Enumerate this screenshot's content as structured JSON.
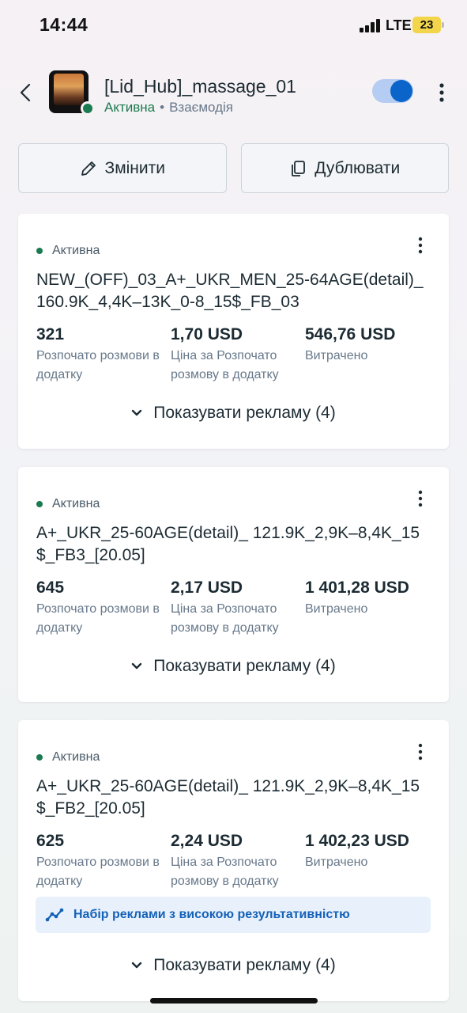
{
  "status_bar": {
    "time": "14:44",
    "network": "LTE",
    "battery": "23"
  },
  "header": {
    "campaign_name": "[Lid_Hub]_massage_01",
    "status": "Активна",
    "separator": "•",
    "mode": "Взаємодія",
    "toggle_on": true
  },
  "actions": {
    "edit_label": "Змінити",
    "duplicate_label": "Дублювати"
  },
  "cards": [
    {
      "status": "Активна",
      "name": "NEW_(OFF)_03_A+_UKR_MEN_25-64AGE(detail)_160.9K_4,4K–13K_0-8_15$_FB_03",
      "metric1_value": "321",
      "metric1_label": "Розпочато розмови в додатку",
      "metric2_value": "1,70 USD",
      "metric2_label": "Ціна за Розпочато розмову в додатку",
      "metric3_value": "546,76 USD",
      "metric3_label": "Витрачено",
      "show_ads": "Показувати рекламу (4)"
    },
    {
      "status": "Активна",
      "name": "A+_UKR_25-60AGE(detail)_ 121.9K_2,9K–8,4K_15$_FB3_[20.05]",
      "metric1_value": "645",
      "metric1_label": "Розпочато розмови в додатку",
      "metric2_value": "2,17 USD",
      "metric2_label": "Ціна за Розпочато розмову в додатку",
      "metric3_value": "1 401,28 USD",
      "metric3_label": "Витрачено",
      "show_ads": "Показувати рекламу (4)"
    },
    {
      "status": "Активна",
      "name": "A+_UKR_25-60AGE(detail)_ 121.9K_2,9K–8,4K_15$_FB2_[20.05]",
      "metric1_value": "625",
      "metric1_label": "Розпочато розмови в додатку",
      "metric2_value": "2,24 USD",
      "metric2_label": "Ціна за Розпочато розмову в додатку",
      "metric3_value": "1 402,23 USD",
      "metric3_label": "Витрачено",
      "banner": "Набір реклами з високою результативністю",
      "show_ads": "Показувати рекламу (4)"
    }
  ],
  "icons": {
    "back": "chevron-left-icon",
    "more": "more-vertical-icon",
    "edit": "pencil-icon",
    "duplicate": "copy-icon",
    "expand": "chevron-down-icon",
    "banner": "trend-line-icon"
  },
  "colors": {
    "active_green": "#1a7a50",
    "toggle_blue": "#0a64c9",
    "banner_text": "#1461b8",
    "banner_bg": "#e8f1fb"
  }
}
